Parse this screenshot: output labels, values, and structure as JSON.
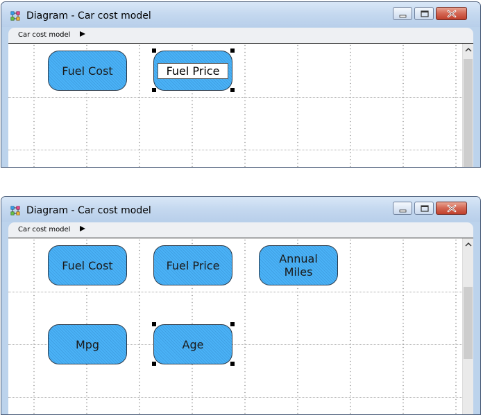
{
  "windows": [
    {
      "title": "Diagram - Car cost model",
      "breadcrumb": "Car cost model",
      "nodes": [
        {
          "label": "Fuel Cost",
          "editing": false,
          "selected": false
        },
        {
          "label": "Fuel Price",
          "editing": true,
          "selected": true
        }
      ]
    },
    {
      "title": "Diagram - Car cost model",
      "breadcrumb": "Car cost model",
      "nodes": [
        {
          "label": "Fuel Cost",
          "editing": false,
          "selected": false
        },
        {
          "label": "Fuel Price",
          "editing": false,
          "selected": false
        },
        {
          "label": "Annual\nMiles",
          "editing": false,
          "selected": false
        },
        {
          "label": "Mpg",
          "editing": false,
          "selected": false
        },
        {
          "label": "Age",
          "editing": false,
          "selected": true
        }
      ]
    }
  ],
  "icons": {
    "app": "diagram-app-icon",
    "minimize": "minimize-icon",
    "maximize": "maximize-icon",
    "close": "close-icon",
    "breadcrumb_arrow": "triangle-right-icon",
    "scroll_up": "chevron-up-icon"
  },
  "colors": {
    "node_fill": "#4ab2f7",
    "titlebar": "#c4d8ef",
    "close_button": "#c0402c"
  }
}
